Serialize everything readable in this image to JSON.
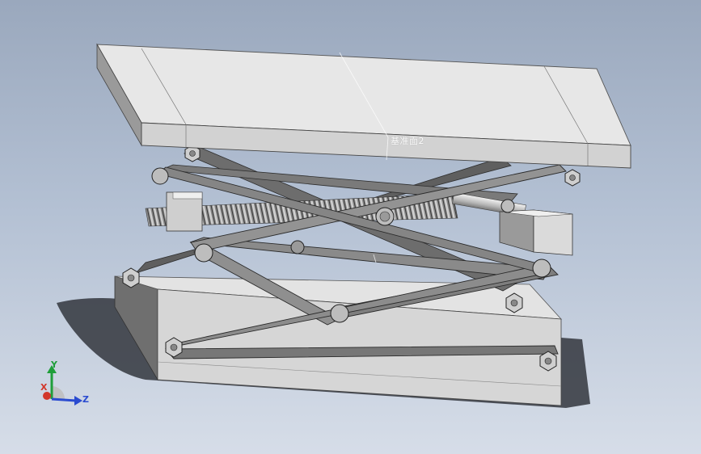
{
  "viewport": {
    "background_top": "#9aa8bd",
    "background_bottom": "#d6dde8"
  },
  "model": {
    "part_color": "#8c8c8c",
    "plate_color": "#e6e6e6"
  },
  "reference_plane": {
    "label": "基准面2"
  },
  "triad": {
    "x_label": "X",
    "y_label": "Y",
    "z_label": "Z",
    "x_color": "#d2372b",
    "y_color": "#1f9e3a",
    "z_color": "#2a4bd0"
  }
}
